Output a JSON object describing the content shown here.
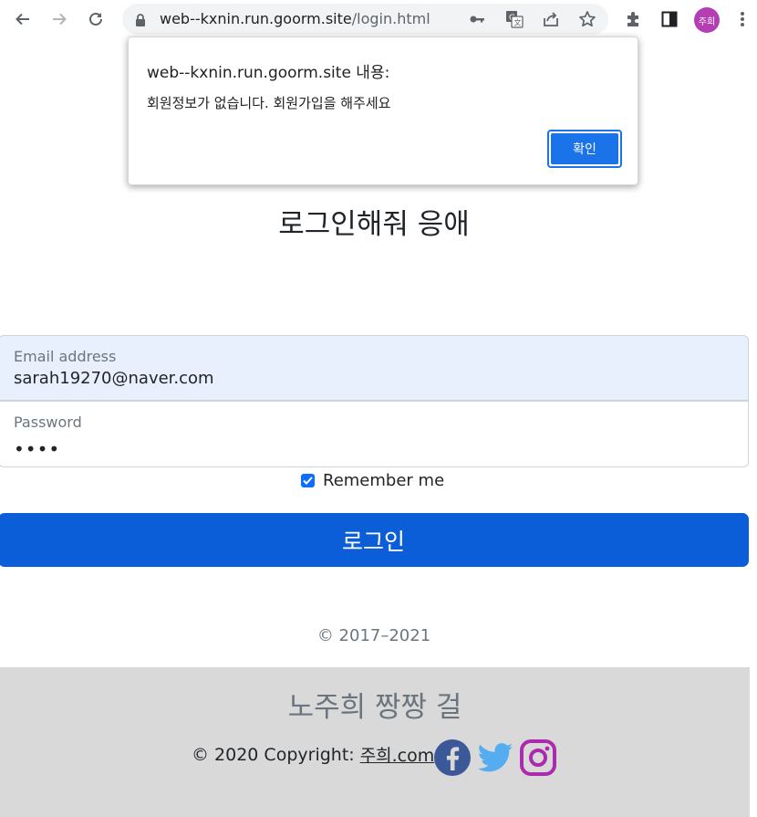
{
  "browser": {
    "url_host": "web--kxnin.run.goorm.site",
    "url_path": "/login.html",
    "profile_initials": "주희",
    "icons": [
      "back-arrow-icon",
      "forward-arrow-icon",
      "reload-icon",
      "lock-icon",
      "key-icon",
      "translate-icon",
      "share-icon",
      "star-icon",
      "extensions-icon",
      "side-panel-icon",
      "menu-icon"
    ]
  },
  "dialog": {
    "title": "web--kxnin.run.goorm.site 내용:",
    "message": "회원정보가 없습니다. 회원가입을 해주세요",
    "ok_label": "확인",
    "accent": "#1a73e8"
  },
  "page": {
    "title": "로그인해줘 응애",
    "email_label": "Email address",
    "email_value": "sarah19270@naver.com",
    "password_label": "Password",
    "password_mask": "••••",
    "remember_label": "Remember me",
    "remember_checked": true,
    "login_label": "로그인",
    "copyright": "© 2017–2021",
    "primary_color": "#0b5ed7"
  },
  "footer": {
    "title": "노주희 짱짱 걸",
    "copyright_prefix": "© 2020 Copyright:",
    "link_text": "주희.com",
    "social": [
      "facebook-icon",
      "twitter-icon",
      "instagram-icon"
    ],
    "facebook_color": "#3b5998",
    "twitter_color": "#55acee",
    "instagram_color": "#ac2bac"
  }
}
